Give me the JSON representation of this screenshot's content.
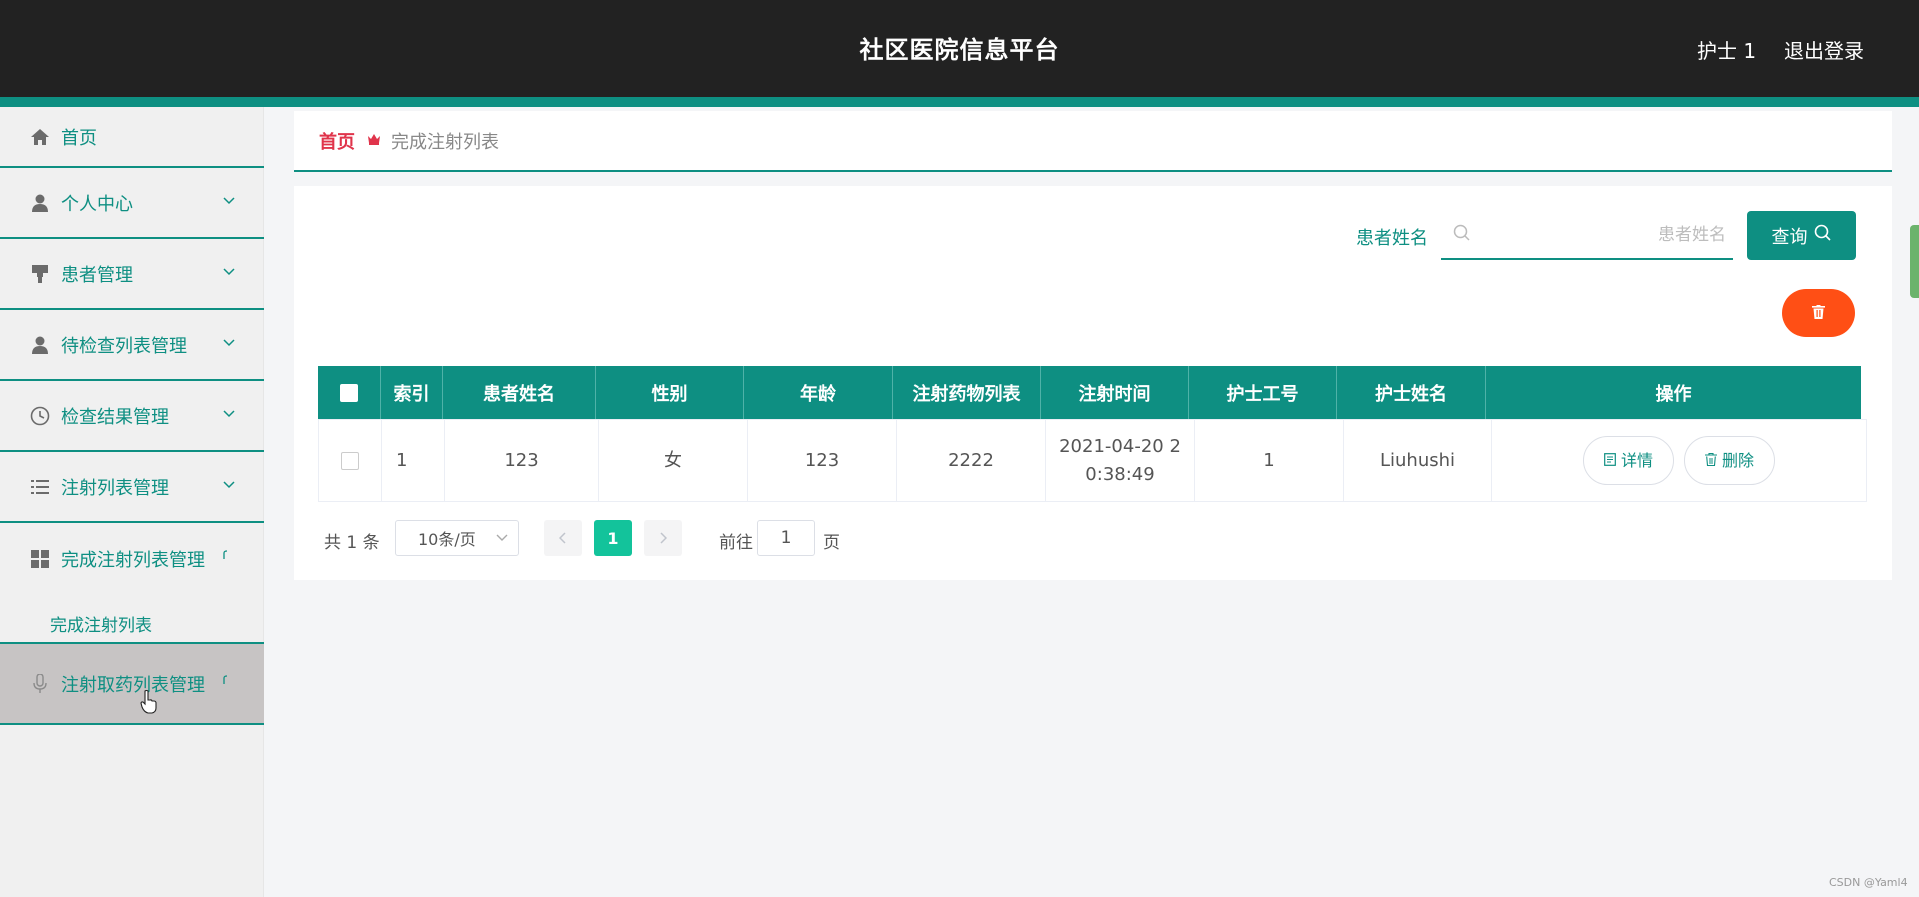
{
  "header": {
    "title": "社区医院信息平台",
    "user": "护士 1",
    "logout": "退出登录"
  },
  "sidebar": {
    "items": [
      {
        "label": "首页",
        "icon": "home-icon"
      },
      {
        "label": "个人中心",
        "icon": "user-icon"
      },
      {
        "label": "患者管理",
        "icon": "stamp-icon"
      },
      {
        "label": "待检查列表管理",
        "icon": "user-icon"
      },
      {
        "label": "检查结果管理",
        "icon": "clock-icon"
      },
      {
        "label": "注射列表管理",
        "icon": "list-icon"
      },
      {
        "label": "完成注射列表管理",
        "icon": "grid-icon"
      },
      {
        "label": "注射取药列表管理",
        "icon": "microphone-icon"
      }
    ],
    "submenu": [
      "完成注射列表"
    ]
  },
  "breadcrumb": {
    "home": "首页",
    "current": "完成注射列表"
  },
  "search": {
    "label": "患者姓名",
    "placeholder": "患者姓名",
    "button": "查询"
  },
  "table": {
    "headers": [
      "索引",
      "患者姓名",
      "性别",
      "年龄",
      "注射药物列表",
      "注射时间",
      "护士工号",
      "护士姓名",
      "操作"
    ],
    "rows": [
      {
        "index": "1",
        "patient_name": "123",
        "gender": "女",
        "age": "123",
        "drugs": "2222",
        "time_line1": "2021-04-20 2",
        "time_line2": "0:38:49",
        "nurse_id": "1",
        "nurse_name": "Liuhushi",
        "detail": "详情",
        "delete": "删除"
      }
    ]
  },
  "pagination": {
    "total": "共 1 条",
    "page_size": "10条/页",
    "current": "1",
    "goto_prefix": "前往",
    "goto_value": "1",
    "goto_suffix": "页"
  },
  "watermark": "CSDN @Yaml4",
  "colors": {
    "accent": "#0e8f82",
    "danger": "#ff4f15",
    "header_bg": "#222222",
    "breadcrumb_home": "#e0344b"
  }
}
